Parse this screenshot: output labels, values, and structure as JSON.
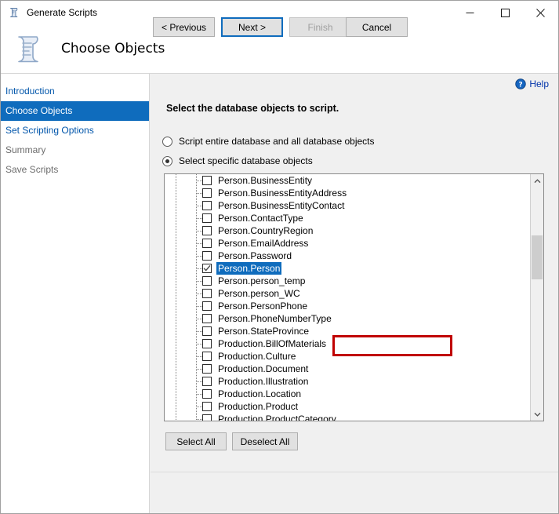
{
  "window": {
    "title": "Generate Scripts",
    "title_icon": "script-scroll-icon",
    "controls": {
      "minimize": "minimize-icon",
      "maximize": "maximize-icon",
      "close": "close-icon"
    }
  },
  "header": {
    "title": "Choose Objects",
    "icon": "script-scroll-large-icon"
  },
  "sidebar": {
    "items": [
      {
        "label": "Introduction",
        "state": "link"
      },
      {
        "label": "Choose Objects",
        "state": "selected"
      },
      {
        "label": "Set Scripting Options",
        "state": "link"
      },
      {
        "label": "Summary",
        "state": "disabled"
      },
      {
        "label": "Save Scripts",
        "state": "disabled"
      }
    ]
  },
  "content": {
    "help_label": "Help",
    "help_icon": "help-circle-icon",
    "instruction": "Select the database objects to script.",
    "radios": [
      {
        "label": "Script entire database and all database objects",
        "selected": false
      },
      {
        "label": "Select specific database objects",
        "selected": true
      }
    ],
    "list_items": [
      {
        "label": "Person.BusinessEntity",
        "checked": false,
        "selected": false
      },
      {
        "label": "Person.BusinessEntityAddress",
        "checked": false,
        "selected": false
      },
      {
        "label": "Person.BusinessEntityContact",
        "checked": false,
        "selected": false
      },
      {
        "label": "Person.ContactType",
        "checked": false,
        "selected": false
      },
      {
        "label": "Person.CountryRegion",
        "checked": false,
        "selected": false
      },
      {
        "label": "Person.EmailAddress",
        "checked": false,
        "selected": false
      },
      {
        "label": "Person.Password",
        "checked": false,
        "selected": false
      },
      {
        "label": "Person.Person",
        "checked": true,
        "selected": true
      },
      {
        "label": "Person.person_temp",
        "checked": false,
        "selected": false
      },
      {
        "label": "Person.person_WC",
        "checked": false,
        "selected": false
      },
      {
        "label": "Person.PersonPhone",
        "checked": false,
        "selected": false
      },
      {
        "label": "Person.PhoneNumberType",
        "checked": false,
        "selected": false
      },
      {
        "label": "Person.StateProvince",
        "checked": false,
        "selected": false
      },
      {
        "label": "Production.BillOfMaterials",
        "checked": false,
        "selected": false
      },
      {
        "label": "Production.Culture",
        "checked": false,
        "selected": false
      },
      {
        "label": "Production.Document",
        "checked": false,
        "selected": false
      },
      {
        "label": "Production.Illustration",
        "checked": false,
        "selected": false
      },
      {
        "label": "Production.Location",
        "checked": false,
        "selected": false
      },
      {
        "label": "Production.Product",
        "checked": false,
        "selected": false
      },
      {
        "label": "Production.ProductCategory",
        "checked": false,
        "selected": false
      }
    ],
    "select_all_label": "Select All",
    "deselect_all_label": "Deselect All"
  },
  "footer": {
    "previous_label": "< Previous",
    "next_label": "Next >",
    "finish_label": "Finish",
    "cancel_label": "Cancel"
  },
  "annotation": {
    "color": "#c00000",
    "target": "Person.Person"
  },
  "colors": {
    "accent": "#0f6cbd",
    "link": "#0055aa",
    "panel": "#f0f0f0",
    "annotation": "#c00000"
  }
}
